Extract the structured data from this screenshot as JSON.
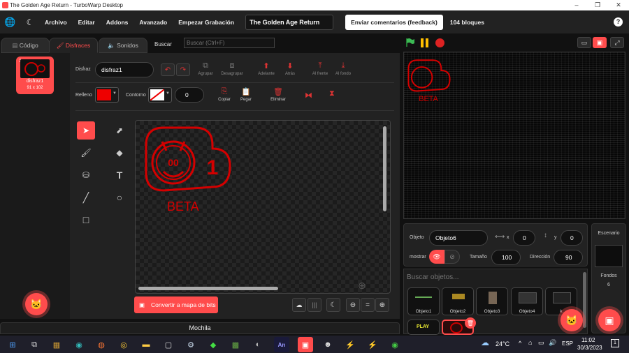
{
  "window": {
    "title": "The Golden Age Return - TurboWarp Desktop",
    "minimize": "–",
    "maximize": "❐",
    "close": "✕"
  },
  "menu": {
    "file": "Archivo",
    "edit": "Editar",
    "addons": "Addons",
    "advanced": "Avanzado",
    "record": "Empezar Grabación",
    "project_title": "The Golden Age Return",
    "feedback": "Enviar comentarios (feedback)",
    "blocks": "104 bloques",
    "help": "?"
  },
  "tabs": {
    "code": "Código",
    "costumes": "Disfraces",
    "sounds": "Sonidos",
    "search_label": "Buscar",
    "search_placeholder": "Buscar (Ctrl+F)"
  },
  "costume_list": [
    {
      "index": "1",
      "name": "disfraz1",
      "size": "91 x 102"
    }
  ],
  "editor": {
    "costume_label": "Disfraz",
    "costume_name": "disfraz1",
    "group": "Agrupar",
    "ungroup": "Desagrupar",
    "forward": "Adelante",
    "backward": "Atrás",
    "front": "Al frente",
    "back": "Al fondo",
    "fill_label": "Relleno",
    "outline_label": "Contorno",
    "outline_width": "0",
    "copy": "Copiar",
    "paste": "Pegar",
    "delete": "Eliminar",
    "convert_bitmap": "Convertir a mapa de bits",
    "zoom_equal": "="
  },
  "art": {
    "badge_number": "1",
    "beta_text": "BETA",
    "face_text": "00"
  },
  "backpack": "Mochila",
  "sprite_info": {
    "label": "Objeto",
    "name": "Objeto6",
    "x_label": "x",
    "x": "0",
    "y_label": "y",
    "y": "0",
    "show_label": "mostrar",
    "size_label": "Tamaño",
    "size": "100",
    "direction_label": "Dirección",
    "direction": "90"
  },
  "sprites_search": "Buscar objetos...",
  "sprites": [
    {
      "name": "Objeto1"
    },
    {
      "name": "Objeto2"
    },
    {
      "name": "Objeto3"
    },
    {
      "name": "Objeto4"
    },
    {
      "name": "k"
    }
  ],
  "sprite_play": "PLAY",
  "stage_panel": {
    "title": "Escenario",
    "backdrops_label": "Fondos",
    "backdrops_count": "6"
  },
  "taskbar": {
    "temperature": "24°C",
    "lang": "ESP",
    "time": "11:02",
    "date": "30/3/2023",
    "an_icon": "An",
    "notif_count": "1"
  },
  "colors": {
    "accent": "#ff4c4c",
    "panel": "#1e1e1e",
    "menubar": "#222222",
    "flag": "#3cba54",
    "pause": "#ffbf00"
  }
}
